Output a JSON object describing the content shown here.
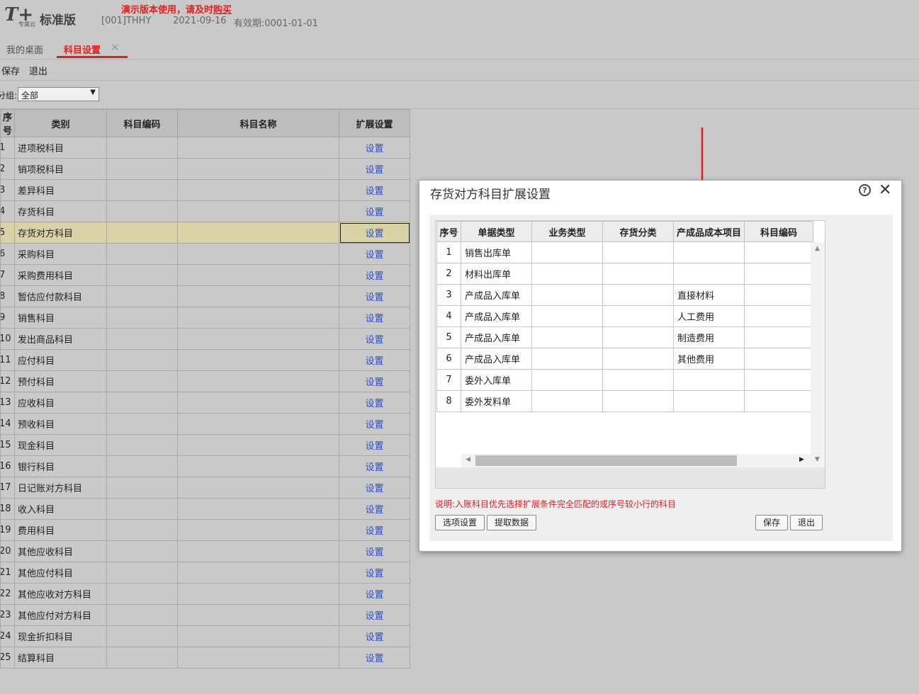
{
  "header": {
    "logo_text": "T+",
    "logo_sub": "专属云",
    "edition": "标准版",
    "demo_notice_prefix": "演示版本使用，请及时",
    "demo_notice_link": "购买",
    "account": "[001]THHY",
    "date": "2021-09-16",
    "validity": "有效期:0001-01-01"
  },
  "tabs": [
    {
      "label": "我的桌面"
    },
    {
      "label": "科目设置"
    }
  ],
  "toolbar": {
    "save": "保存",
    "exit": "退出"
  },
  "filter": {
    "label": "分组:",
    "value": "全部"
  },
  "grid": {
    "columns": [
      "序号",
      "类别",
      "科目编码",
      "科目名称",
      "扩展设置"
    ],
    "link_text": "设置",
    "rows": [
      {
        "no": "1",
        "category": "进项税科目"
      },
      {
        "no": "2",
        "category": "销项税科目"
      },
      {
        "no": "3",
        "category": "差异科目"
      },
      {
        "no": "4",
        "category": "存货科目"
      },
      {
        "no": "5",
        "category": "存货对方科目"
      },
      {
        "no": "6",
        "category": "采购科目"
      },
      {
        "no": "7",
        "category": "采购费用科目"
      },
      {
        "no": "8",
        "category": "暂估应付款科目"
      },
      {
        "no": "9",
        "category": "销售科目"
      },
      {
        "no": "10",
        "category": "发出商品科目"
      },
      {
        "no": "11",
        "category": "应付科目"
      },
      {
        "no": "12",
        "category": "预付科目"
      },
      {
        "no": "13",
        "category": "应收科目"
      },
      {
        "no": "14",
        "category": "预收科目"
      },
      {
        "no": "15",
        "category": "现金科目"
      },
      {
        "no": "16",
        "category": "银行科目"
      },
      {
        "no": "17",
        "category": "日记账对方科目"
      },
      {
        "no": "18",
        "category": "收入科目"
      },
      {
        "no": "19",
        "category": "费用科目"
      },
      {
        "no": "20",
        "category": "其他应收科目"
      },
      {
        "no": "21",
        "category": "其他应付科目"
      },
      {
        "no": "22",
        "category": "其他应收对方科目"
      },
      {
        "no": "23",
        "category": "其他应付对方科目"
      },
      {
        "no": "24",
        "category": "现金折扣科目"
      },
      {
        "no": "25",
        "category": "结算科目"
      }
    ],
    "selected_row": "5"
  },
  "dialog": {
    "title": "存货对方科目扩展设置",
    "help_icon": "?",
    "close_icon": "✕",
    "columns": [
      "序号",
      "单据类型",
      "业务类型",
      "存货分类",
      "产成品成本项目",
      "科目编码"
    ],
    "rows": [
      {
        "no": "1",
        "doc_type": "销售出库单",
        "biz_type": "",
        "inv_class": "",
        "cost_item": "",
        "code": ""
      },
      {
        "no": "2",
        "doc_type": "材料出库单",
        "biz_type": "",
        "inv_class": "",
        "cost_item": "",
        "code": ""
      },
      {
        "no": "3",
        "doc_type": "产成品入库单",
        "biz_type": "",
        "inv_class": "",
        "cost_item": "直接材料",
        "code": ""
      },
      {
        "no": "4",
        "doc_type": "产成品入库单",
        "biz_type": "",
        "inv_class": "",
        "cost_item": "人工费用",
        "code": ""
      },
      {
        "no": "5",
        "doc_type": "产成品入库单",
        "biz_type": "",
        "inv_class": "",
        "cost_item": "制造费用",
        "code": ""
      },
      {
        "no": "6",
        "doc_type": "产成品入库单",
        "biz_type": "",
        "inv_class": "",
        "cost_item": "其他费用",
        "code": ""
      },
      {
        "no": "7",
        "doc_type": "委外入库单",
        "biz_type": "",
        "inv_class": "",
        "cost_item": "",
        "code": ""
      },
      {
        "no": "8",
        "doc_type": "委外发料单",
        "biz_type": "",
        "inv_class": "",
        "cost_item": "",
        "code": ""
      }
    ],
    "note": "说明:入账科目优先选择扩展条件完全匹配的或序号较小行的科目",
    "buttons": {
      "options": "选项设置",
      "fetch": "提取数据",
      "save": "保存",
      "exit": "退出"
    }
  },
  "colors": {
    "accent_red": "#e02020",
    "link_blue": "#2a4fd6",
    "selected_row": "#d8d2a6"
  }
}
